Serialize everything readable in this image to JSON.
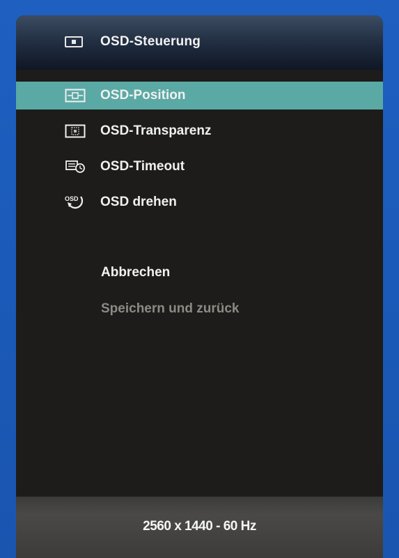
{
  "header": {
    "title": "OSD-Steuerung",
    "icon": "osd-control-icon"
  },
  "menu": {
    "items": [
      {
        "label": "OSD-Position",
        "icon": "osd-position-icon",
        "selected": true
      },
      {
        "label": "OSD-Transparenz",
        "icon": "osd-transparency-icon",
        "selected": false
      },
      {
        "label": "OSD-Timeout",
        "icon": "osd-timeout-icon",
        "selected": false
      },
      {
        "label": "OSD drehen",
        "icon": "osd-rotate-icon",
        "selected": false
      }
    ]
  },
  "actions": {
    "cancel_label": "Abbrechen",
    "save_label": "Speichern und zurück"
  },
  "footer": {
    "resolution": "2560 x 1440 - 60 Hz"
  },
  "colors": {
    "selected_bg": "#5aa9a4",
    "panel_bg": "#1d1c1a",
    "desktop_bg": "#1b5ab8",
    "disabled_text": "#8d8a85"
  }
}
